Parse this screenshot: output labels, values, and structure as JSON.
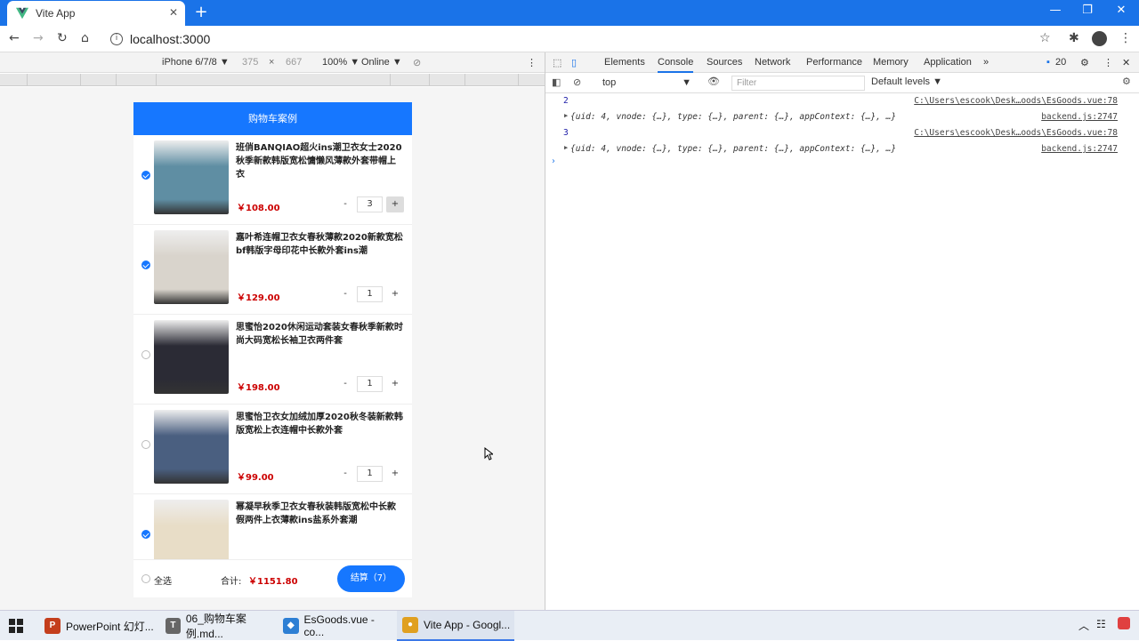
{
  "browser": {
    "tab_title": "Vite App",
    "tab_close": "✕",
    "new_tab": "+",
    "url": "localhost:3000",
    "window_controls": [
      "—",
      "❐",
      "✕"
    ]
  },
  "device_toolbar": {
    "device": "iPhone 6/7/8 ▼",
    "width": "375",
    "x": "×",
    "height": "667",
    "zoom": "100% ▼",
    "network": "Online ▼"
  },
  "app": {
    "header": "购物车案例",
    "goods": [
      {
        "title": "班俏BANQIAO超火ins潮卫衣女士2020秋季新款韩版宽松慵懒风薄款外套带帽上衣",
        "price": "￥108.00",
        "count": "3",
        "checked": true,
        "color": "#5f8ea3",
        "plus_highlight": true
      },
      {
        "title": "嘉叶希连帽卫衣女春秋薄款2020新款宽松bf韩版字母印花中长款外套ins潮",
        "price": "￥129.00",
        "count": "1",
        "checked": true,
        "color": "#d9d4cc",
        "plus_highlight": false
      },
      {
        "title": "思蜜怡2020休闲运动套装女春秋季新款时尚大码宽松长袖卫衣两件套",
        "price": "￥198.00",
        "count": "1",
        "checked": false,
        "color": "#2b2b35",
        "plus_highlight": false
      },
      {
        "title": "思蜜怡卫衣女加绒加厚2020秋冬装新款韩版宽松上衣连帽中长款外套",
        "price": "￥99.00",
        "count": "1",
        "checked": false,
        "color": "#4a5f80",
        "plus_highlight": false
      },
      {
        "title": "幂凝早秋季卫衣女春秋装韩版宽松中长款假两件上衣薄款ins盐系外套潮",
        "price": "",
        "count": "",
        "checked": true,
        "color": "#e8ddc7",
        "plus_highlight": false
      }
    ],
    "footer": {
      "select_all": "全选",
      "total_label": "合计:",
      "total": "￥1151.80",
      "checkout": "结算（7）"
    }
  },
  "devtools": {
    "tabs": [
      "Elements",
      "Console",
      "Sources",
      "Network",
      "Performance",
      "Memory",
      "Application",
      "»"
    ],
    "active_tab": "Console",
    "issues_count": "20",
    "context": "top",
    "filter_placeholder": "Filter",
    "levels": "Default levels ▼",
    "console": [
      {
        "kind": "value",
        "text": "2",
        "source": "C:\\Users\\escook\\Desk…oods\\EsGoods.vue:78"
      },
      {
        "kind": "object",
        "text": "{uid: 4, vnode: {…}, type: {…}, parent: {…}, appContext: {…}, …}",
        "source": "backend.js:2747"
      },
      {
        "kind": "value",
        "text": "3",
        "source": "C:\\Users\\escook\\Desk…oods\\EsGoods.vue:78"
      },
      {
        "kind": "object",
        "text": "{uid: 4, vnode: {…}, type: {…}, parent: {…}, appContext: {…}, …}",
        "source": "backend.js:2747"
      }
    ],
    "prompt": "›"
  },
  "taskbar": {
    "items": [
      {
        "label": "PowerPoint 幻灯...",
        "icon": "P",
        "color": "#c43e1c"
      },
      {
        "label": "06_购物车案例.md...",
        "icon": "T",
        "color": "#666666"
      },
      {
        "label": "EsGoods.vue - co...",
        "icon": "◆",
        "color": "#2d7fd4"
      },
      {
        "label": "Vite App - Googl...",
        "icon": "●",
        "color": "#e0a020"
      }
    ]
  }
}
